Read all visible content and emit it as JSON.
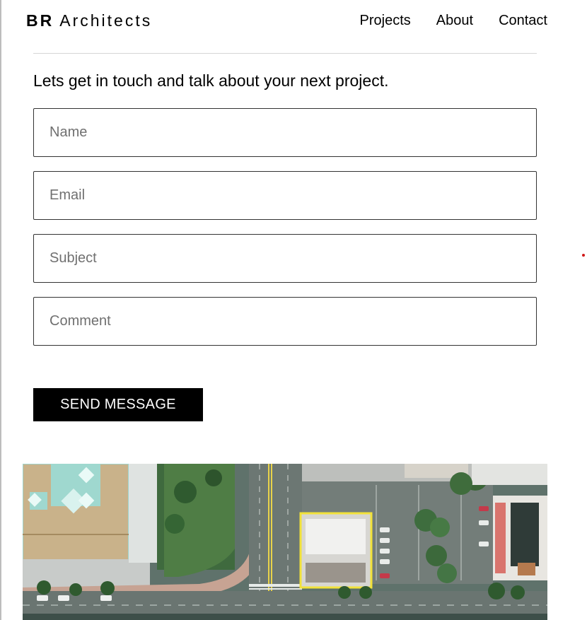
{
  "brand": {
    "strong": "BR",
    "rest": "Architects"
  },
  "nav": {
    "items": [
      "Projects",
      "About",
      "Contact"
    ]
  },
  "intro": {
    "text": "Lets get in touch and talk about your next project."
  },
  "form": {
    "name_placeholder": "Name",
    "email_placeholder": "Email",
    "subject_placeholder": "Subject",
    "comment_placeholder": "Comment",
    "submit_label": "SEND MESSAGE"
  },
  "colors": {
    "button_bg": "#000000",
    "button_text": "#ffffff",
    "highlight_box": "#f2e23a"
  }
}
